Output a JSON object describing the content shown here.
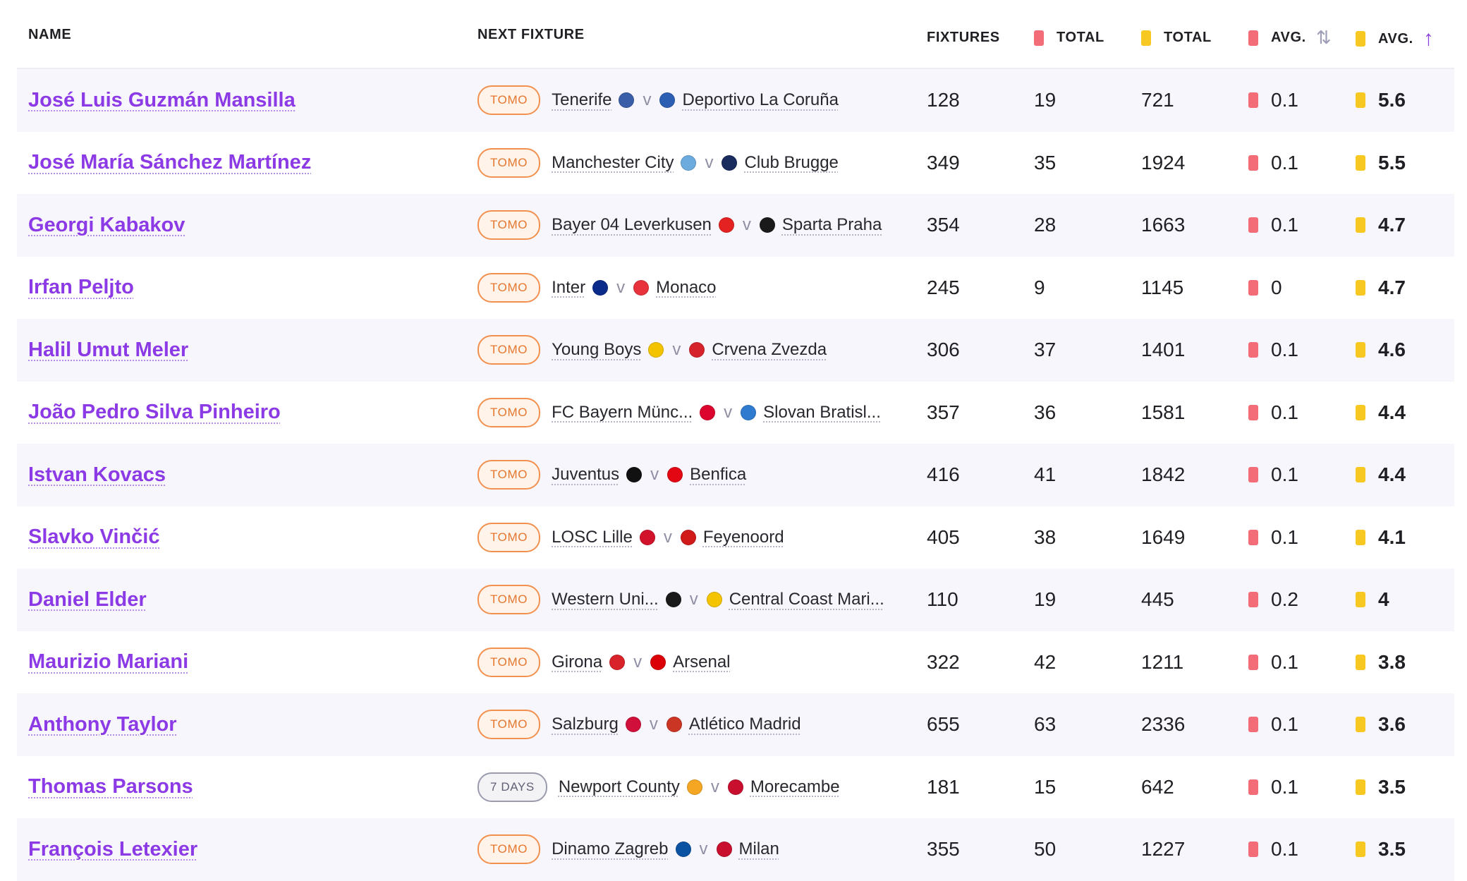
{
  "header": {
    "name": "NAME",
    "next_fixture": "NEXT FIXTURE",
    "fixtures": "FIXTURES",
    "red_total": "TOTAL",
    "yellow_total": "TOTAL",
    "red_avg": "AVG.",
    "yellow_avg": "AVG.",
    "sort_neutral_glyph": "⇅",
    "sort_active_glyph": "↑"
  },
  "colors": {
    "red_card": "#f26d78",
    "yellow_card": "#f8c822",
    "link": "#8b3ae5",
    "badge_tomo": "#f2914f",
    "badge_days": "#9a9cae"
  },
  "rows": [
    {
      "name": "José Luis Guzmán Mansilla",
      "badge": "TOMO",
      "badge_type": "tomo",
      "home": "Tenerife",
      "home_color": "#3a5fa8",
      "away": "Deportivo La Coruña",
      "away_color": "#2c5fb3",
      "fixtures": "128",
      "red_total": "19",
      "yellow_total": "721",
      "red_avg": "0.1",
      "yellow_avg": "5.6"
    },
    {
      "name": "José María Sánchez Martínez",
      "badge": "TOMO",
      "badge_type": "tomo",
      "home": "Manchester City",
      "home_color": "#6cabdd",
      "away": "Club Brugge",
      "away_color": "#1a2b5e",
      "fixtures": "349",
      "red_total": "35",
      "yellow_total": "1924",
      "red_avg": "0.1",
      "yellow_avg": "5.5"
    },
    {
      "name": "Georgi Kabakov",
      "badge": "TOMO",
      "badge_type": "tomo",
      "home": "Bayer 04 Leverkusen",
      "home_color": "#e32221",
      "away": "Sparta Praha",
      "away_color": "#1a1a1a",
      "fixtures": "354",
      "red_total": "28",
      "yellow_total": "1663",
      "red_avg": "0.1",
      "yellow_avg": "4.7"
    },
    {
      "name": "Irfan Peljto",
      "badge": "TOMO",
      "badge_type": "tomo",
      "home": "Inter",
      "home_color": "#0b2b8a",
      "away": "Monaco",
      "away_color": "#e8333c",
      "fixtures": "245",
      "red_total": "9",
      "yellow_total": "1145",
      "red_avg": "0",
      "yellow_avg": "4.7"
    },
    {
      "name": "Halil Umut Meler",
      "badge": "TOMO",
      "badge_type": "tomo",
      "home": "Young Boys",
      "home_color": "#f4c300",
      "away": "Crvena Zvezda",
      "away_color": "#d6232b",
      "fixtures": "306",
      "red_total": "37",
      "yellow_total": "1401",
      "red_avg": "0.1",
      "yellow_avg": "4.6"
    },
    {
      "name": "João Pedro Silva Pinheiro",
      "badge": "TOMO",
      "badge_type": "tomo",
      "home": "FC Bayern Münc...",
      "home_color": "#dc052d",
      "away": "Slovan Bratisl...",
      "away_color": "#2f7bd0",
      "fixtures": "357",
      "red_total": "36",
      "yellow_total": "1581",
      "red_avg": "0.1",
      "yellow_avg": "4.4"
    },
    {
      "name": "Istvan Kovacs",
      "badge": "TOMO",
      "badge_type": "tomo",
      "home": "Juventus",
      "home_color": "#111111",
      "away": "Benfica",
      "away_color": "#e30613",
      "fixtures": "416",
      "red_total": "41",
      "yellow_total": "1842",
      "red_avg": "0.1",
      "yellow_avg": "4.4"
    },
    {
      "name": "Slavko Vinčić",
      "badge": "TOMO",
      "badge_type": "tomo",
      "home": "LOSC Lille",
      "home_color": "#d2112b",
      "away": "Feyenoord",
      "away_color": "#d11a1a",
      "fixtures": "405",
      "red_total": "38",
      "yellow_total": "1649",
      "red_avg": "0.1",
      "yellow_avg": "4.1"
    },
    {
      "name": "Daniel Elder",
      "badge": "TOMO",
      "badge_type": "tomo",
      "home": "Western Uni...",
      "home_color": "#1a1a1a",
      "away": "Central Coast Mari...",
      "away_color": "#f5c400",
      "fixtures": "110",
      "red_total": "19",
      "yellow_total": "445",
      "red_avg": "0.2",
      "yellow_avg": "4"
    },
    {
      "name": "Maurizio Mariani",
      "badge": "TOMO",
      "badge_type": "tomo",
      "home": "Girona",
      "home_color": "#d8232a",
      "away": "Arsenal",
      "away_color": "#db0007",
      "fixtures": "322",
      "red_total": "42",
      "yellow_total": "1211",
      "red_avg": "0.1",
      "yellow_avg": "3.8"
    },
    {
      "name": "Anthony Taylor",
      "badge": "TOMO",
      "badge_type": "tomo",
      "home": "Salzburg",
      "home_color": "#d0103a",
      "away": "Atlético Madrid",
      "away_color": "#cb3524",
      "fixtures": "655",
      "red_total": "63",
      "yellow_total": "2336",
      "red_avg": "0.1",
      "yellow_avg": "3.6"
    },
    {
      "name": "Thomas Parsons",
      "badge": "7 DAYS",
      "badge_type": "days",
      "home": "Newport County",
      "home_color": "#f5a623",
      "away": "Morecambe",
      "away_color": "#c8102e",
      "fixtures": "181",
      "red_total": "15",
      "yellow_total": "642",
      "red_avg": "0.1",
      "yellow_avg": "3.5"
    },
    {
      "name": "François Letexier",
      "badge": "TOMO",
      "badge_type": "tomo",
      "home": "Dinamo Zagreb",
      "home_color": "#0b52a3",
      "away": "Milan",
      "away_color": "#c8102e",
      "fixtures": "355",
      "red_total": "50",
      "yellow_total": "1227",
      "red_avg": "0.1",
      "yellow_avg": "3.5"
    }
  ]
}
